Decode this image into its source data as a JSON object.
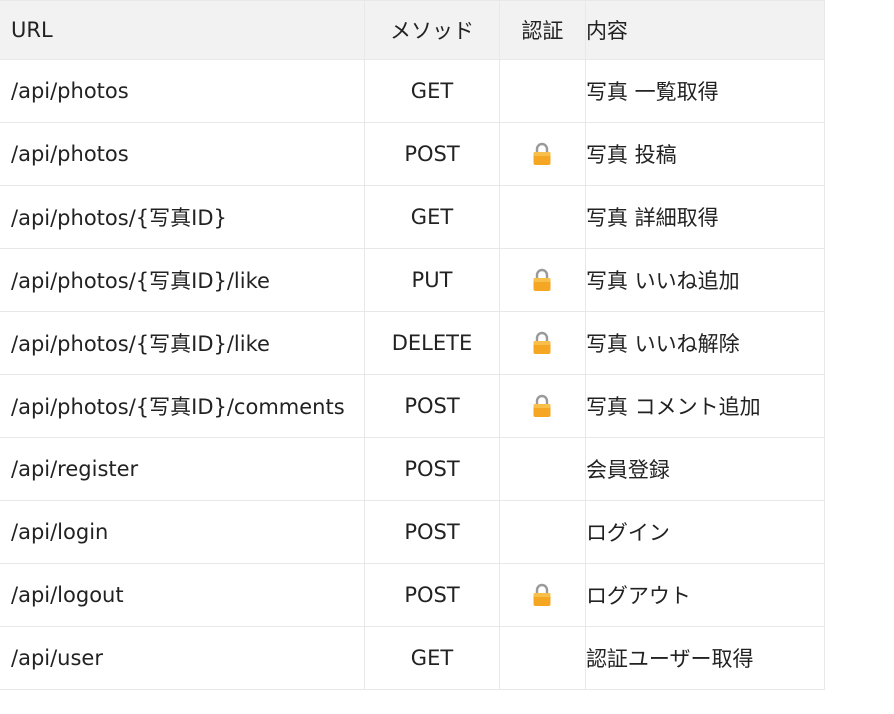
{
  "headers": {
    "url": "URL",
    "method": "メソッド",
    "auth": "認証",
    "desc": "内容"
  },
  "auth_icon": "lock-icon",
  "colors": {
    "header_bg": "#f2f2f2",
    "border": "#e8e8e8",
    "lock_body": "#f5a623",
    "lock_shackle": "#9a9a9a"
  },
  "rows": [
    {
      "url": "/api/photos",
      "method": "GET",
      "auth": false,
      "desc": "写真 一覧取得"
    },
    {
      "url": "/api/photos",
      "method": "POST",
      "auth": true,
      "desc": "写真 投稿"
    },
    {
      "url": "/api/photos/{写真ID}",
      "method": "GET",
      "auth": false,
      "desc": "写真 詳細取得"
    },
    {
      "url": "/api/photos/{写真ID}/like",
      "method": "PUT",
      "auth": true,
      "desc": "写真 いいね追加"
    },
    {
      "url": "/api/photos/{写真ID}/like",
      "method": "DELETE",
      "auth": true,
      "desc": "写真 いいね解除"
    },
    {
      "url": "/api/photos/{写真ID}/comments",
      "method": "POST",
      "auth": true,
      "desc": "写真 コメント追加"
    },
    {
      "url": "/api/register",
      "method": "POST",
      "auth": false,
      "desc": "会員登録"
    },
    {
      "url": "/api/login",
      "method": "POST",
      "auth": false,
      "desc": "ログイン"
    },
    {
      "url": "/api/logout",
      "method": "POST",
      "auth": true,
      "desc": "ログアウト"
    },
    {
      "url": "/api/user",
      "method": "GET",
      "auth": false,
      "desc": "認証ユーザー取得"
    }
  ]
}
